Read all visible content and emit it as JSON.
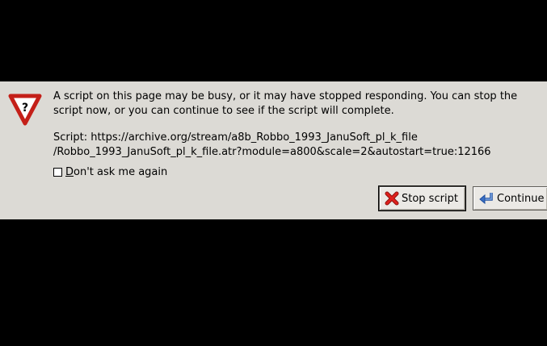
{
  "dialog": {
    "message_lines": [
      "A script on this page may be busy, or it may have stopped responding. You can stop the",
      "script now, or you can continue to see if the script will complete."
    ],
    "script_lines": [
      "Script: https://archive.org/stream/a8b_Robbo_1993_JanuSoft_pl_k_file",
      "/Robbo_1993_JanuSoft_pl_k_file.atr?module=a800&scale=2&autostart=true:12166"
    ],
    "dont_ask": {
      "mnemonic": "D",
      "rest": "on't ask me again",
      "checked": false
    },
    "buttons": {
      "stop_label": "Stop script",
      "continue_label": "Continue"
    },
    "icons": {
      "warning": "warning-question-icon",
      "stop": "red-x-icon",
      "continue": "return-arrow-icon"
    },
    "colors": {
      "background": "#dcdad5",
      "warning_red": "#d3281f",
      "stop_red": "#e0201c",
      "continue_blue": "#3a6fc4"
    }
  }
}
